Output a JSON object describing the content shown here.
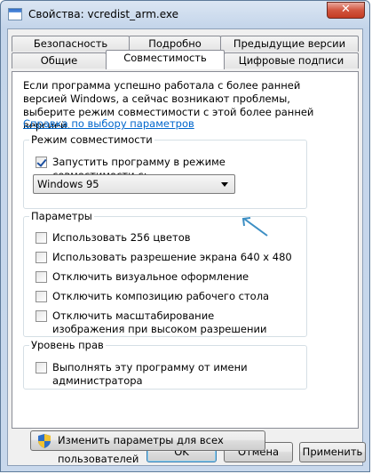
{
  "window": {
    "title": "Свойства: vcredist_arm.exe",
    "close_label": "✕"
  },
  "tabs": {
    "row_back": [
      "Безопасность",
      "Подробно",
      "Предыдущие версии"
    ],
    "row_front": [
      "Общие",
      "Совместимость",
      "Цифровые подписи"
    ],
    "active": "Совместимость"
  },
  "compat": {
    "intro": "Если программа успешно работала с более ранней версией Windows, а сейчас возникают проблемы, выберите режим совместимости с этой более ранней версией.",
    "help_link": "Справка по выбору параметров",
    "mode_group": {
      "title": "Режим совместимости",
      "run_compat_label": "Запустить программу в режиме совместимости с:",
      "run_compat_checked": true,
      "os_selected": "Windows 95"
    },
    "settings_group": {
      "title": "Параметры",
      "options": [
        {
          "label": "Использовать 256 цветов",
          "checked": false
        },
        {
          "label": "Использовать разрешение экрана 640 x 480",
          "checked": false
        },
        {
          "label": "Отключить визуальное оформление",
          "checked": false
        },
        {
          "label": "Отключить композицию рабочего стола",
          "checked": false
        },
        {
          "label": "Отключить масштабирование изображения при высоком разрешении экрана",
          "checked": false
        }
      ]
    },
    "privilege_group": {
      "title": "Уровень прав",
      "run_as_admin_label": "Выполнять эту программу от имени администратора",
      "run_as_admin_checked": false
    },
    "change_all_label": "Изменить параметры для всех пользователей"
  },
  "buttons": {
    "ok": "OK",
    "cancel": "Отмена",
    "apply": "Применить"
  },
  "colors": {
    "link": "#0066cc",
    "arrow_annotation": "#3d8fc4"
  }
}
